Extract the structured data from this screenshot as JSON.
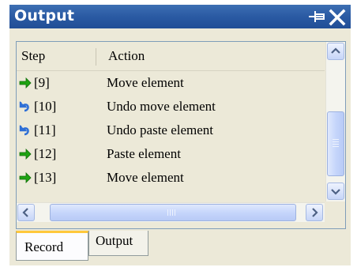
{
  "window": {
    "title": "Output",
    "pin_icon": "pin-icon",
    "close_icon": "close-icon"
  },
  "list": {
    "columns": {
      "step": "Step",
      "action": "Action"
    },
    "rows": [
      {
        "icon": "redo-arrow-icon",
        "step": "[9]",
        "action": "Move element"
      },
      {
        "icon": "undo-arrow-icon",
        "step": "[10]",
        "action": "Undo move element"
      },
      {
        "icon": "undo-arrow-icon",
        "step": "[11]",
        "action": "Undo paste element"
      },
      {
        "icon": "redo-arrow-icon",
        "step": "[12]",
        "action": "Paste element"
      },
      {
        "icon": "redo-arrow-icon",
        "step": "[13]",
        "action": "Move element"
      }
    ]
  },
  "tabs": [
    {
      "label": "Record",
      "active": true
    },
    {
      "label": "Output",
      "active": false
    }
  ],
  "colors": {
    "titlebar": "#2a5aa3",
    "redo_arrow": "#1fa312",
    "undo_arrow": "#2e6fd6",
    "active_tab_accent": "#ffc83c"
  }
}
